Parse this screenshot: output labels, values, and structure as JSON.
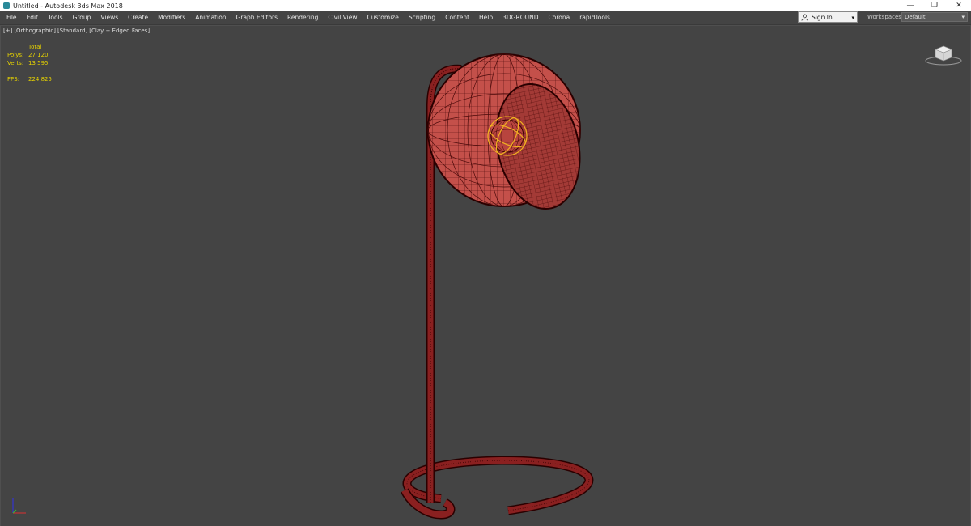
{
  "title": "Untitled - Autodesk 3ds Max 2018",
  "window_controls": {
    "minimize": "—",
    "restore": "❐",
    "close": "✕"
  },
  "menu": [
    "File",
    "Edit",
    "Tools",
    "Group",
    "Views",
    "Create",
    "Modifiers",
    "Animation",
    "Graph Editors",
    "Rendering",
    "Civil View",
    "Customize",
    "Scripting",
    "Content",
    "Help",
    "3DGROUND",
    "Corona",
    "rapidTools"
  ],
  "signin": {
    "label": "Sign In",
    "arrow": "▾"
  },
  "workspaces": {
    "label": "Workspaces:",
    "value": "Default",
    "arrow": "▾"
  },
  "viewport": {
    "labels": [
      "[+]",
      "[Orthographic]",
      "[Standard]",
      "[Clay + Edged Faces]"
    ],
    "stats": {
      "header": "Total",
      "polys_label": "Polys:",
      "polys_value": "27 120",
      "verts_label": "Verts:",
      "verts_value": "13 595",
      "fps_label": "FPS:",
      "fps_value": "224,825"
    }
  },
  "colors": {
    "viewport_bg": "#444444",
    "mesh_fill": "#c4504a",
    "mesh_wire": "#3a0000",
    "selection": "#f0b020",
    "stats_text": "#e6d200"
  }
}
